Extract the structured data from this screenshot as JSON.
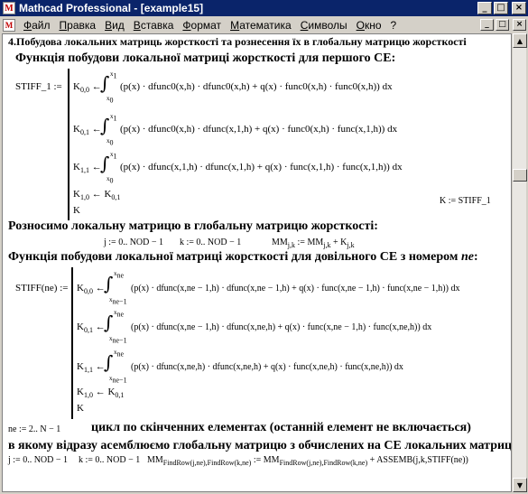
{
  "window": {
    "title": "Mathcad Professional - [example15]",
    "minimize": "_",
    "maximize": "□",
    "close": "×",
    "app_icon": "mathcad-icon"
  },
  "menu": [
    "Файл",
    "Правка",
    "Вид",
    "Вставка",
    "Формат",
    "Математика",
    "Символы",
    "Окно",
    "?"
  ],
  "doc": {
    "heading": "4.Побудова локальних матриць жорсткості та рознесення їх в глобальну матрицю жорсткості",
    "sub1": "Функція побудови локальної матриці жорсткості для першого СЕ:",
    "stiff1": {
      "name": "STIFF_1 :=",
      "r1_lhs": "K",
      "r1_idx": "0,0",
      "r1_body": "(p(x) · dfunc0(x,h) · dfunc0(x,h) + q(x) · func0(x,h) · func0(x,h)) dx",
      "r2_idx": "0,1",
      "r2_body": "(p(x) · dfunc0(x,h) · dfunc(x,1,h) + q(x) · func0(x,h) · func(x,1,h)) dx",
      "r3_idx": "1,1",
      "r3_body": "(p(x) · dfunc(x,1,h) · dfunc(x,1,h) + q(x) · func(x,1,h) · func(x,1,h)) dx",
      "r4": "K",
      "r4_idx": "1,0",
      "r4_rhs": "K",
      "r4_rhs_idx": "0,1",
      "r5": "K",
      "lim_top": "x",
      "lim_top_idx": "1",
      "lim_bot": "x",
      "lim_bot_idx": "0",
      "arrow": "←",
      "k_assign": "K := STIFF_1"
    },
    "sub2": "Розносимо локальну матрицю в глобальну матрицю жорсткості:",
    "range_j": "j := 0.. NOD − 1",
    "range_k": "k := 0.. NOD − 1",
    "mm_assign_lhs": "MM",
    "mm_assign_mid": " := MM",
    "mm_assign_plus": " + K",
    "jk": "j,k",
    "sub3a": "Функція побудови локальної матриці жорсткості для довільного СЕ з номером ",
    "sub3b": "ne",
    "sub3c": ":",
    "stiff2": {
      "name": "STIFF(ne) :=",
      "r1_body": "(p(x) · dfunc(x,ne − 1,h) · dfunc(x,ne − 1,h) + q(x) · func(x,ne − 1,h) · func(x,ne − 1,h)) dx",
      "r2_body": "(p(x) · dfunc(x,ne − 1,h) · dfunc(x,ne,h) + q(x) · func(x,ne − 1,h) · func(x,ne,h)) dx",
      "r3_body": "(p(x) · dfunc(x,ne,h) · dfunc(x,ne,h) + q(x) · func(x,ne,h) · func(x,ne,h)) dx",
      "lim_top": "x",
      "lim_top_idx": "ne",
      "lim_bot": "x",
      "lim_bot_idx": "ne−1"
    },
    "range_ne": "ne := 2.. N − 1",
    "loop_comment": "цикл по скінченних елементах (останній елемент не включається)",
    "assemble_comment": "в якому відразу асемблюємо глобальну матрицю з обчислених на СЕ локальних матриць:",
    "final_lhs": "MM",
    "final_idx": "FindRow(j,ne),FindRow(k,ne)",
    "final_mid": " := MM",
    "final_rhs": " + ASSEMB(j,k,STIFF(ne))"
  },
  "colors": {
    "titlebar": "#0a246a",
    "chrome": "#d4d0c8",
    "marker": "#ff0000"
  }
}
